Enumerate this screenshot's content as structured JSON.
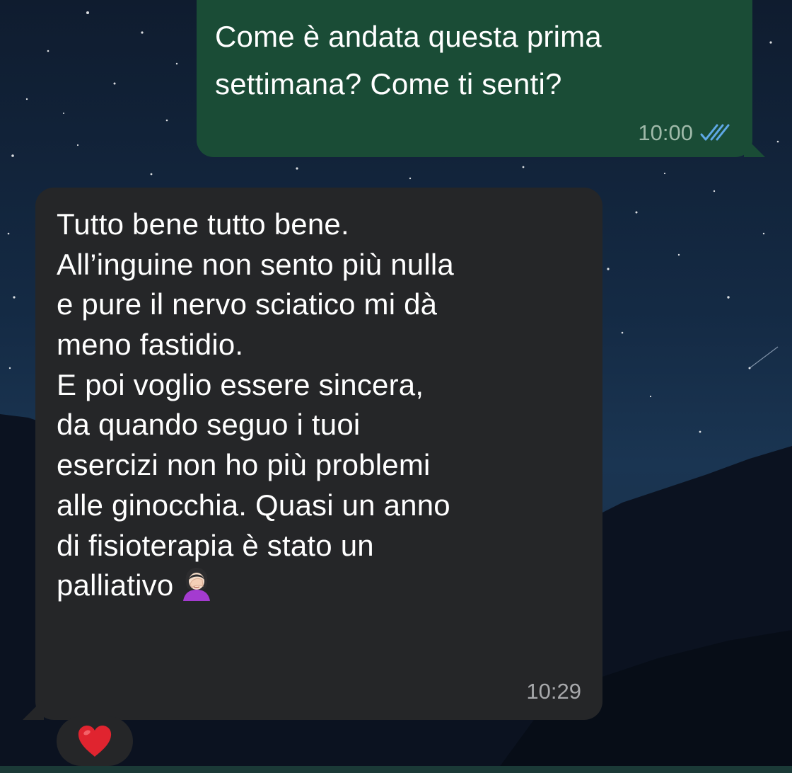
{
  "chat": {
    "outgoing": {
      "text": "Come è andata questa prima\nsettimana? Come ti senti?",
      "time": "10:00",
      "status_icon": "double-check-read-icon"
    },
    "incoming": {
      "text": "Tutto bene tutto bene.\nAll’inguine non sento più nulla\ne pure il nervo sciatico mi dà\nmeno fastidio.\nE poi voglio essere sincera,\nda quando seguo i tuoi\nesercizi non ho più problemi\nalle ginocchia. Quasi un anno\ndi fisioterapia è stato un\npalliativo",
      "emoji": "woman-facepalming-icon",
      "time": "10:29"
    },
    "reaction": {
      "emoji": "red-heart-icon"
    }
  },
  "colors": {
    "outgoing_bubble": "#1a4c36",
    "incoming_bubble": "#252628",
    "read_ticks": "#5fa8e6",
    "heart": "#e0242f"
  }
}
